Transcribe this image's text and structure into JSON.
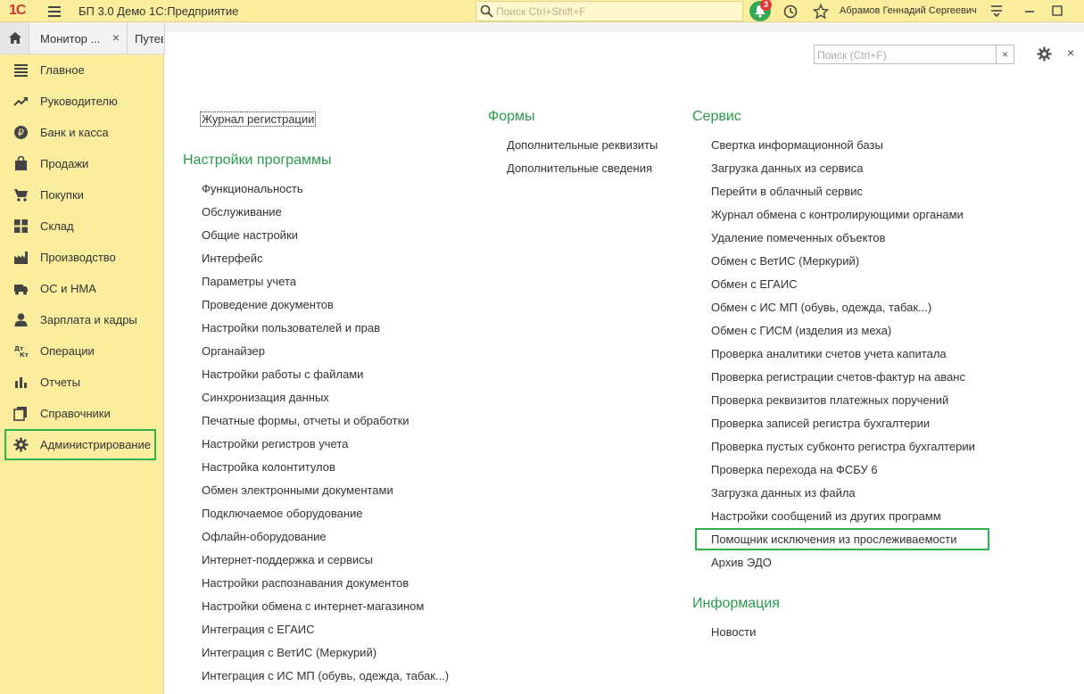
{
  "topbar": {
    "logo": "1С",
    "title": "БП 3.0 Демо 1С:Предприятие",
    "search_placeholder": "Поиск Ctrl+Shift+F",
    "notif_count": "3",
    "user": "Абрамов Геннадий Сергеевич"
  },
  "tabs": [
    {
      "label": "Монитор ..."
    },
    {
      "label": "Путев"
    }
  ],
  "sidebar": {
    "items": [
      {
        "label": "Главное",
        "icon": "menu-lines-icon"
      },
      {
        "label": "Руководителю",
        "icon": "trend-icon"
      },
      {
        "label": "Банк и касса",
        "icon": "ruble-coin-icon"
      },
      {
        "label": "Продажи",
        "icon": "shopping-bag-icon"
      },
      {
        "label": "Покупки",
        "icon": "cart-icon"
      },
      {
        "label": "Склад",
        "icon": "grid-icon"
      },
      {
        "label": "Производство",
        "icon": "factory-icon"
      },
      {
        "label": "ОС и НМА",
        "icon": "truck-icon"
      },
      {
        "label": "Зарплата и кадры",
        "icon": "person-icon"
      },
      {
        "label": "Операции",
        "icon": "dt-kt-icon"
      },
      {
        "label": "Отчеты",
        "icon": "bar-chart-icon"
      },
      {
        "label": "Справочники",
        "icon": "books-icon"
      },
      {
        "label": "Администрирование",
        "icon": "gear-icon"
      }
    ],
    "active": "Администрирование"
  },
  "form": {
    "search_placeholder": "Поиск (Ctrl+F)",
    "clear": "×",
    "close": "×"
  },
  "col1": {
    "top_link": "Журнал регистрации",
    "section": "Настройки программы",
    "links": [
      "Функциональность",
      "Обслуживание",
      "Общие настройки",
      "Интерфейс",
      "Параметры учета",
      "Проведение документов",
      "Настройки пользователей и прав",
      "Органайзер",
      "Настройки работы с файлами",
      "Синхронизация данных",
      "Печатные формы, отчеты и обработки",
      "Настройки регистров учета",
      "Настройка колонтитулов",
      "Обмен электронными документами",
      "Подключаемое оборудование",
      "Офлайн-оборудование",
      "Интернет-поддержка и сервисы",
      "Настройки распознавания документов",
      "Настройки обмена с интернет-магазином",
      "Интеграция с ЕГАИС",
      "Интеграция с ВетИС (Меркурий)",
      "Интеграция с ИС МП (обувь, одежда, табак...)"
    ]
  },
  "col2": {
    "section": "Формы",
    "links": [
      "Дополнительные реквизиты",
      "Дополнительные сведения"
    ]
  },
  "col3": {
    "section": "Сервис",
    "links": [
      "Свертка информационной базы",
      "Загрузка данных из сервиса",
      "Перейти в облачный сервис",
      "Журнал обмена с контролирующими органами",
      "Удаление помеченных объектов",
      "Обмен с ВетИС (Меркурий)",
      "Обмен с ЕГАИС",
      "Обмен с ИС МП (обувь, одежда, табак...)",
      "Обмен с ГИСМ (изделия из меха)",
      "Проверка аналитики счетов учета капитала",
      "Проверка регистрации счетов-фактур на аванс",
      "Проверка реквизитов платежных поручений",
      "Проверка записей регистра бухгалтерии",
      "Проверка пустых субконто регистра бухгалтерии",
      "Проверка перехода на ФСБУ 6",
      "Загрузка данных из файла",
      "Настройки сообщений из других программ",
      "Помощник исключения из прослеживаемости",
      "Архив ЭДО"
    ],
    "section2": "Информация",
    "links2": [
      "Новости"
    ]
  },
  "colors": {
    "accent_green": "#2a9a4c",
    "highlight": "#2db34a",
    "panel_yellow": "#fbed9e"
  }
}
